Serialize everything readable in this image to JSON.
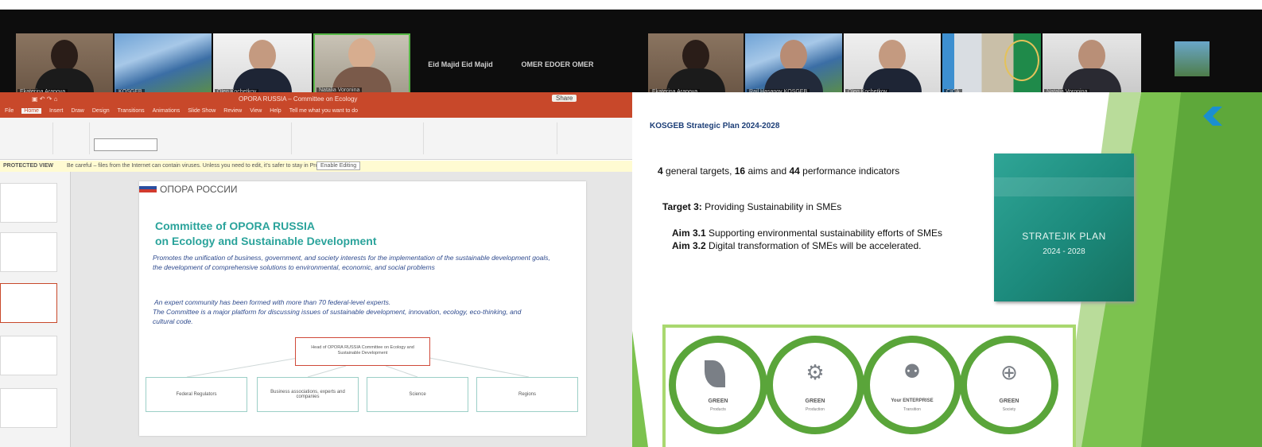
{
  "left_screen": {
    "tiles": [
      {
        "caption": "Ekaterina Arapova"
      },
      {
        "caption": "KOSGEB"
      },
      {
        "caption": "Oleg Kochetkov"
      },
      {
        "caption": "Natalia Voronina"
      }
    ],
    "name_tiles": [
      {
        "name": "Eid Majid",
        "caption": "Eid Majid"
      },
      {
        "name": "OMER EDOER",
        "caption": "OMER EDOER"
      }
    ],
    "powerpoint": {
      "title": "OPORA RUSSIA – Committee on Ecology",
      "share_button": "Share",
      "tabs": [
        "File",
        "Home",
        "Insert",
        "Draw",
        "Design",
        "Transitions",
        "Animations",
        "Slide Show",
        "Review",
        "View",
        "Help",
        "Tell me what you want to do"
      ],
      "banner_label": "PROTECTED VIEW",
      "banner_text": "Be careful – files from the Internet can contain viruses. Unless you need to edit, it's safer to stay in Protected View.",
      "banner_button": "Enable Editing",
      "slide": {
        "logo_text": "ОПОРА РОССИИ",
        "title_line1": "Committee of OPORA RUSSIA",
        "title_line2": "on Ecology and Sustainable Development",
        "para1": "Promotes the unification of business, government, and society interests for the implementation of the sustainable development goals, the development of comprehensive solutions to environmental, economic, and social problems",
        "para2_line1": "An expert community has been formed with more than 70 federal-level experts.",
        "para2_line2": "The Committee is a major platform for discussing issues of sustainable development, innovation, ecology, eco-thinking, and cultural code.",
        "center_box": "Head of OPORA RUSSIA Committee on Ecology and Sustainable Development",
        "bottom_boxes": [
          "Federal Regulators",
          "Business associations, experts and companies",
          "Science",
          "Regions"
        ]
      }
    }
  },
  "right_screen": {
    "tiles": [
      {
        "caption": "Ekaterina Arapova"
      },
      {
        "caption": "Rail Hasanov KOSGEB"
      },
      {
        "caption": "Oleg Kochetkov"
      },
      {
        "caption": "CICA"
      },
      {
        "caption": "Natalia Voronina"
      }
    ],
    "slide": {
      "header": "KOSGEB Strategic Plan 2024-2028",
      "summary": {
        "prefix_num": "4",
        "part1": " general targets, ",
        "num2": "16",
        "part2": " aims and ",
        "num3": "44",
        "part3": " performance indicators"
      },
      "target_label": "Target 3:",
      "target_text": " Providing Sustainability in SMEs",
      "aims": [
        {
          "label": "Aim 3.1",
          "text": " Supporting environmental sustainability efforts of SMEs"
        },
        {
          "label": "Aim 3.2",
          "text": " Digital transformation of SMEs will be accelerated."
        }
      ],
      "book": {
        "line1": "STRATEJIK PLAN",
        "line2": "2024 - 2028"
      },
      "circles": [
        {
          "label": "GREEN",
          "sub": "Products",
          "icon": "leaf-icon"
        },
        {
          "label": "GREEN",
          "sub": "Production",
          "icon": "gears-icon"
        },
        {
          "label": "Your ENTERPRISE",
          "sub": "Transition",
          "icon": "people-icon"
        },
        {
          "label": "GREEN",
          "sub": "Society",
          "icon": "globe-icon"
        }
      ]
    }
  },
  "colors": {
    "ppt_red": "#c8482a",
    "opora_teal": "#2aa39b",
    "kosgeb_green": "#6bb244",
    "book_teal": "#1c8a7c"
  }
}
